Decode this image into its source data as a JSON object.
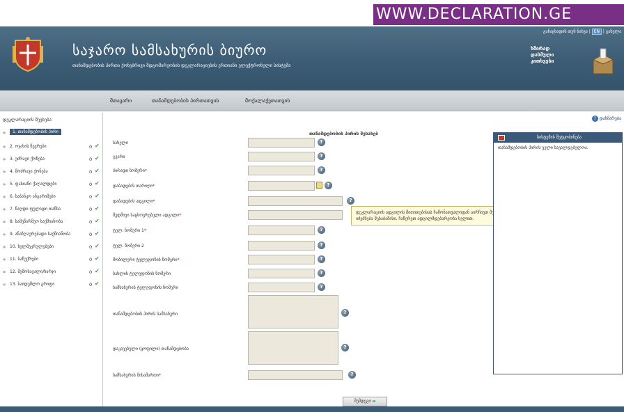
{
  "watermark": "WWW.DECLARATION.GE",
  "header": {
    "top_link_1": "განაცხადის თუნ ნახვა |",
    "top_link_lang": "EN",
    "top_link_2": "| გასვლა",
    "title": "საჯარო სამსახურის ბიურო",
    "subtitle": "თანამდებობის პირთა ქონებრივი მდგომარეობის დეკლარაციების ერთიანი ელექტრონული სისტემა",
    "box_line_1": "ხშირად",
    "box_line_2": "დასმული",
    "box_line_3": "კითხვები"
  },
  "nav": {
    "items": [
      "მთავარი",
      "თანამდებობის პირთათვის",
      "მოქალაქეთათვის"
    ]
  },
  "sidebar": {
    "title": "დეკლარაციის შევსება",
    "items": [
      {
        "label": "1. თანამდებობის პირი",
        "count": "",
        "active": true
      },
      {
        "label": "2. ოჯახის წევრები",
        "count": "0"
      },
      {
        "label": "3. უძრავი ქონება",
        "count": "0"
      },
      {
        "label": "4. მოძრავი ქონება",
        "count": "0"
      },
      {
        "label": "5. ფასიანი ქაღალდები",
        "count": "0"
      },
      {
        "label": "6. საბანკო ანგარიშები",
        "count": "0"
      },
      {
        "label": "7. ნაღდი ფულადი თანხა",
        "count": "0"
      },
      {
        "label": "8. სამეწარმეო საქმიანობა",
        "count": "0"
      },
      {
        "label": "9. ანაზღაურებადი საქმიანობა",
        "count": "0"
      },
      {
        "label": "10. ხელშეკრულებები",
        "count": "0"
      },
      {
        "label": "11. საჩუქრები",
        "count": "0"
      },
      {
        "label": "12. შემოსავალი/ხარჯი",
        "count": "0"
      },
      {
        "label": "13. საიდუმლო გრიფი",
        "count": "0"
      }
    ]
  },
  "main": {
    "help_label": "დახმარება",
    "form_title": "თანამდებობის პირის შესახებ",
    "fields": [
      {
        "label": "სახელი",
        "required": false
      },
      {
        "label": "გვარი",
        "required": false
      },
      {
        "label": "პირადი ნომერი",
        "required": true
      },
      {
        "label": "დაბადების თარიღი",
        "required": true
      },
      {
        "label": "დაბადების ადგილი",
        "required": true
      },
      {
        "label": "მუდმივი საცხოვრებელი ადგილი",
        "required": true
      },
      {
        "label": "ტელ. ნომერი 1",
        "required": true
      },
      {
        "label": "ტელ. ნომერი 2",
        "required": false
      },
      {
        "label": "მობილური ტელეფონის ნომერი",
        "required": true
      },
      {
        "label": "სახლის ტელეფონის ნომერი",
        "required": false
      },
      {
        "label": "სამსახურის ტელეფონის ნომერი",
        "required": false
      }
    ],
    "area_1_label": "თანამდებობის პირის სამსახური",
    "area_2_label": "დაკავებული (ყოფილი) თანამდებობა",
    "last_field_label": "სამსახურის მისამართი",
    "tooltip": "დეკლარაციის ადგილის მითითებისას ჩამონათვალიდან აირჩიეთ შესაბამისი. თუ ჩამონათვალში არ იძებნება შესაბამისი, ჩაწერეთ ადგილმდებარეობა ხელით.",
    "notice_title": "სისტემის შეტყობინება",
    "notice_text": "თანამდებობის პირის ველი სავალდებულოა.",
    "submit_label": "შემდეგი"
  }
}
